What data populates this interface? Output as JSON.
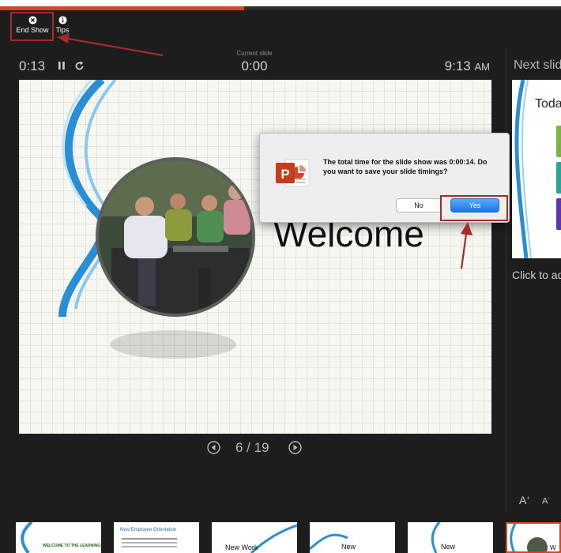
{
  "toolbar": {
    "end_show_label": "End Show",
    "tips_label": "Tips"
  },
  "presenter": {
    "elapsed_time": "0:13",
    "current_slide_label": "Current slide",
    "current_slide_time": "0:00",
    "clock_time": "9:13",
    "clock_ampm": "AM",
    "next_slide_label": "Next slide",
    "progress_fraction": 0.435
  },
  "slide": {
    "title": "Welcome"
  },
  "dialog": {
    "message": "The total time for the slide show was 0:00:14. Do you want to save your slide timings?",
    "no_label": "No",
    "yes_label": "Yes"
  },
  "navigation": {
    "counter": "6 / 19"
  },
  "next_preview": {
    "title": "Toda"
  },
  "notes": {
    "placeholder": "Click to add notes"
  },
  "filmstrip": [
    {
      "text": "WELCOME TO THE LEARNING"
    },
    {
      "text": "New Employee Orientation"
    },
    {
      "text": "New Work"
    },
    {
      "text": "New"
    },
    {
      "text": "New"
    },
    {
      "text": "W"
    }
  ],
  "colors": {
    "background": "#1d1d1d",
    "accent": "#d24726",
    "callout_red": "#a32b2b",
    "yes_blue": "#1a78e6"
  }
}
